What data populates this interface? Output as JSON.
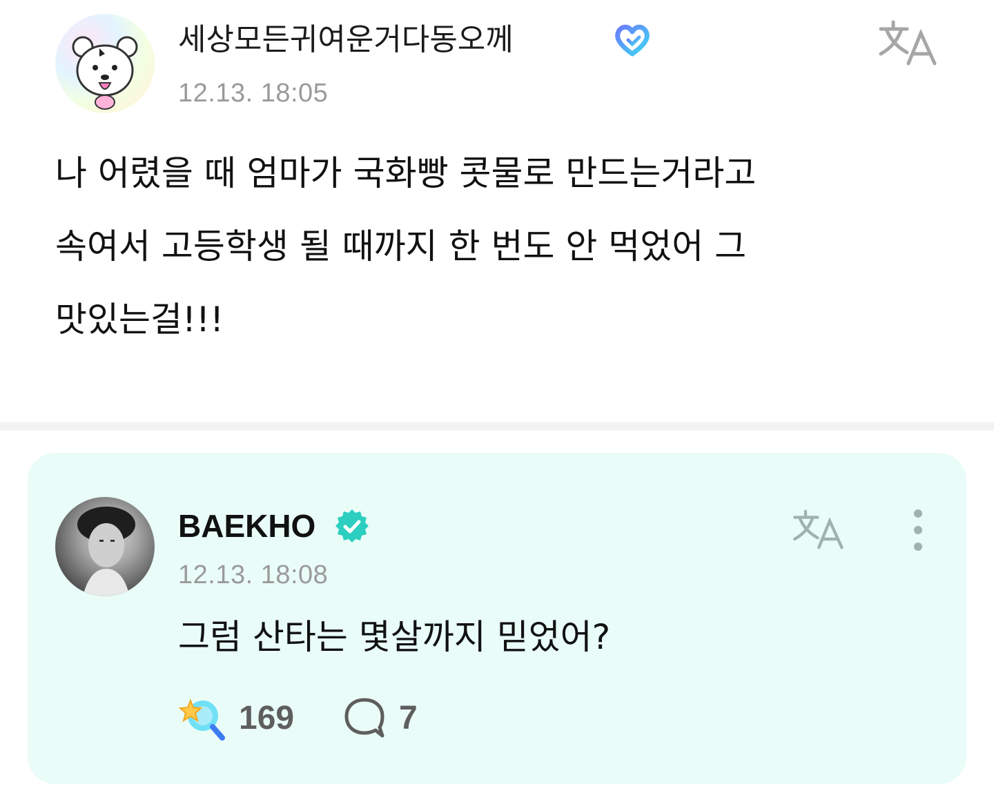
{
  "fan_post": {
    "username": "세상모든귀여운거다동오께",
    "timestamp": "12.13. 18:05",
    "body_lines": [
      "나 어렸을 때 엄마가 국화빵 콧물로 만드는거라고",
      "속여서 고등학생 될 때까지 한 번도 안 먹었어 그",
      "맛있는걸!!!"
    ],
    "avatar_icon": "cartoon-bear-avatar",
    "badge_icon": "membership-heart-icon",
    "translate_icon": "translate-icon"
  },
  "artist_reply": {
    "username": "BAEKHO",
    "verified_icon": "verified-check-icon",
    "timestamp": "12.13. 18:08",
    "body": "그럼 산타는 몇살까지 믿었어?",
    "likes": "169",
    "comments": "7",
    "like_icon": "star-lollipop-icon",
    "comment_icon": "speech-bubble-icon",
    "more_icon": "more-vertical-icon",
    "translate_icon": "translate-icon"
  },
  "colors": {
    "card_bg": "#e9fcf8",
    "verified": "#2ccfbf",
    "timestamp": "#9a9a9a",
    "badge_gradient_start": "#6b7cff",
    "badge_gradient_end": "#3fd8f0"
  }
}
